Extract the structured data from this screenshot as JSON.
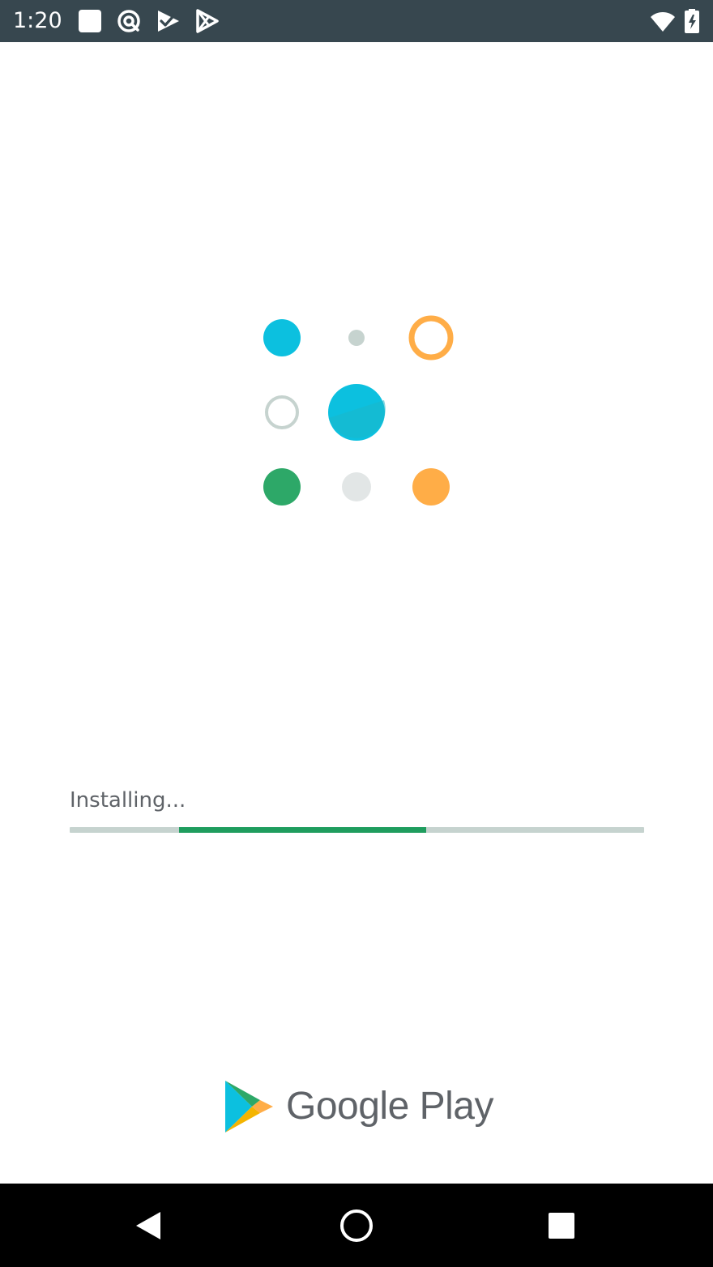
{
  "status_bar": {
    "time": "1:20",
    "left_icons": [
      "notification-square-icon",
      "at-sign-circle-icon",
      "check-flag-icon",
      "play-outline-icon"
    ],
    "right_icons": [
      "wifi-icon",
      "battery-charging-icon"
    ],
    "background": "#37474f"
  },
  "illustration": {
    "dots": [
      {
        "name": "dot-teal-filled",
        "color": "#0cc0df",
        "style": "filled"
      },
      {
        "name": "dot-gray-small",
        "color": "#c6d3cf",
        "style": "filled"
      },
      {
        "name": "dot-orange-ring",
        "color": "#ffad47",
        "style": "ring"
      },
      {
        "name": "dot-gray-ring",
        "color": "#c6d3cf",
        "style": "ring"
      },
      {
        "name": "dot-teal-large",
        "color": "#0cc0df",
        "style": "filled"
      },
      {
        "name": "dot-green-filled",
        "color": "#2da868",
        "style": "filled"
      },
      {
        "name": "dot-gray-faded",
        "color": "#e2e6e6",
        "style": "filled"
      },
      {
        "name": "dot-orange-filled",
        "color": "#ffad47",
        "style": "filled"
      }
    ]
  },
  "install": {
    "label": "Installing...",
    "progress_start": 0.19,
    "progress_end": 0.62,
    "track_color": "#c6d3cf",
    "fill_color": "#1f9d5e"
  },
  "brand": {
    "name": "Google Play",
    "icon": "google-play-logo-icon"
  },
  "nav_bar": {
    "buttons": [
      {
        "name": "back-button",
        "icon": "back-triangle-icon"
      },
      {
        "name": "home-button",
        "icon": "home-circle-icon"
      },
      {
        "name": "recents-button",
        "icon": "recents-square-icon"
      }
    ]
  }
}
